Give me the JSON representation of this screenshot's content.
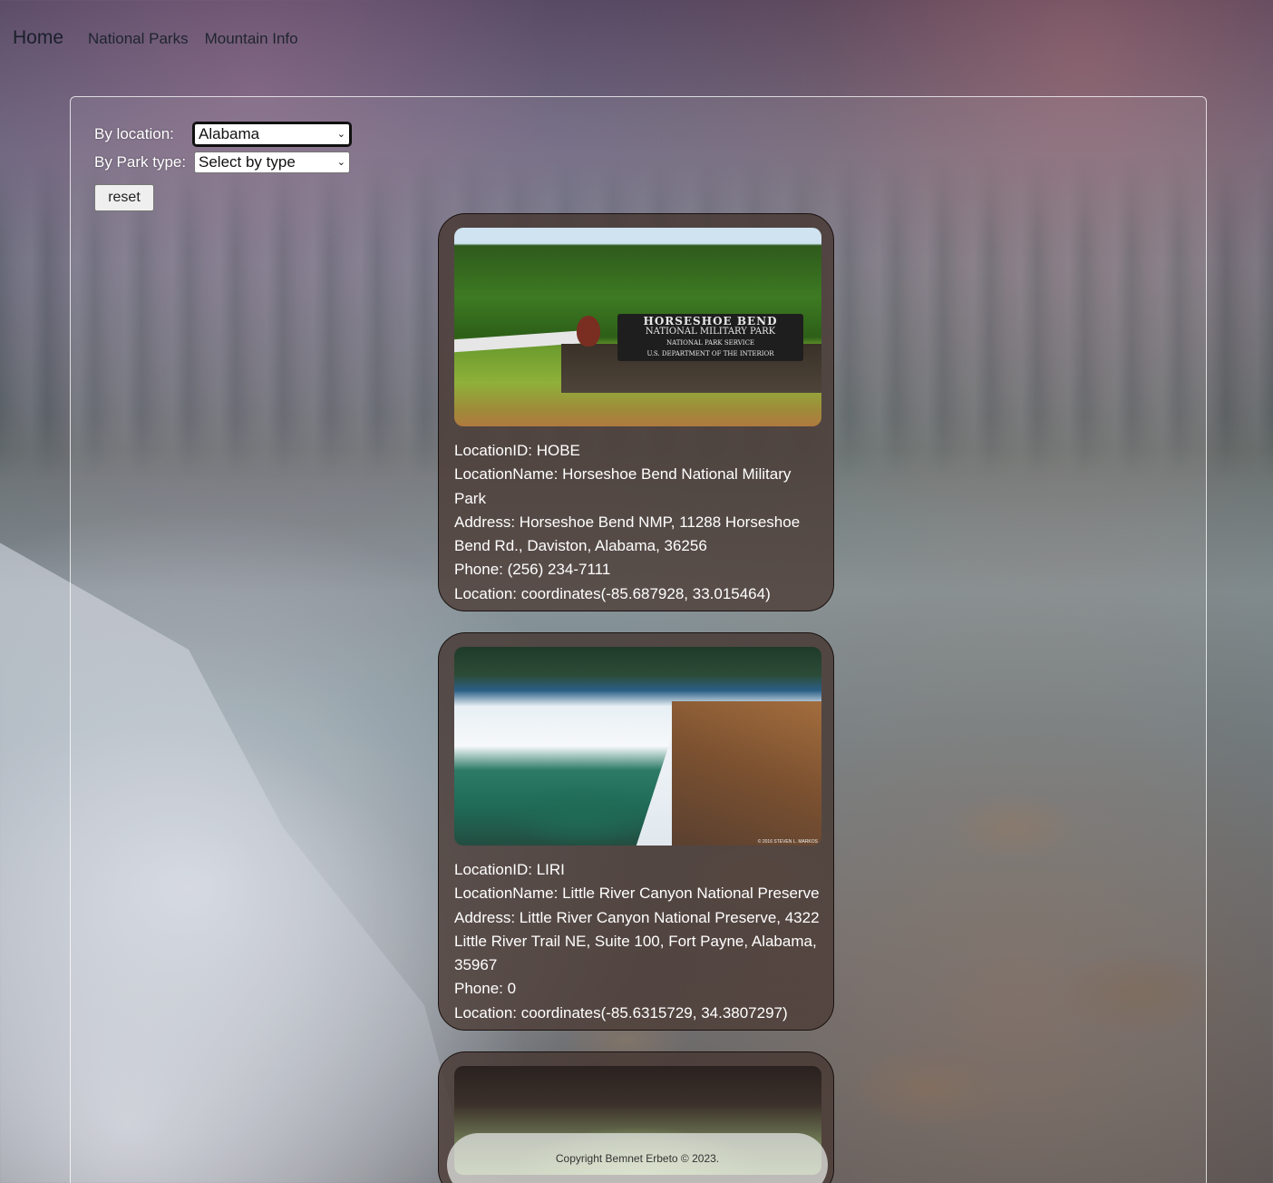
{
  "nav": {
    "brand": "Home",
    "links": [
      "National Parks",
      "Mountain Info"
    ]
  },
  "filters": {
    "location_label": "By location:",
    "location_value": "Alabama",
    "type_label": "By Park type:",
    "type_value": "Select by type",
    "reset_label": "reset"
  },
  "cards": [
    {
      "image_icon": "horseshoe-bend-sign-photo",
      "sign_lines": [
        "HORSESHOE BEND",
        "NATIONAL MILITARY PARK",
        "NATIONAL PARK SERVICE",
        "U.S. DEPARTMENT OF THE INTERIOR"
      ],
      "location_id": "LocationID: HOBE",
      "location_name": "LocationName: Horseshoe Bend National Military Park",
      "address": "Address: Horseshoe Bend NMP, 11288 Horseshoe Bend Rd., Daviston, Alabama, 36256",
      "phone": "Phone: (256) 234-7111",
      "location": "Location: coordinates(-85.687928, 33.015464)"
    },
    {
      "image_icon": "little-river-canyon-waterfall-photo",
      "image_credit": "© 2016 STEVEN L. MARKOS",
      "location_id": "LocationID: LIRI",
      "location_name": "LocationName: Little River Canyon National Preserve",
      "address": "Address: Little River Canyon National Preserve, 4322 Little River Trail NE, Suite 100, Fort Payne, Alabama, 35967",
      "phone": "Phone: 0",
      "location": "Location: coordinates(-85.6315729, 34.3807297)"
    },
    {
      "image_icon": "natural-bridge-cave-photo"
    }
  ],
  "footer": {
    "copyright": "Copyright Bemnet Erbeto © 2023."
  }
}
